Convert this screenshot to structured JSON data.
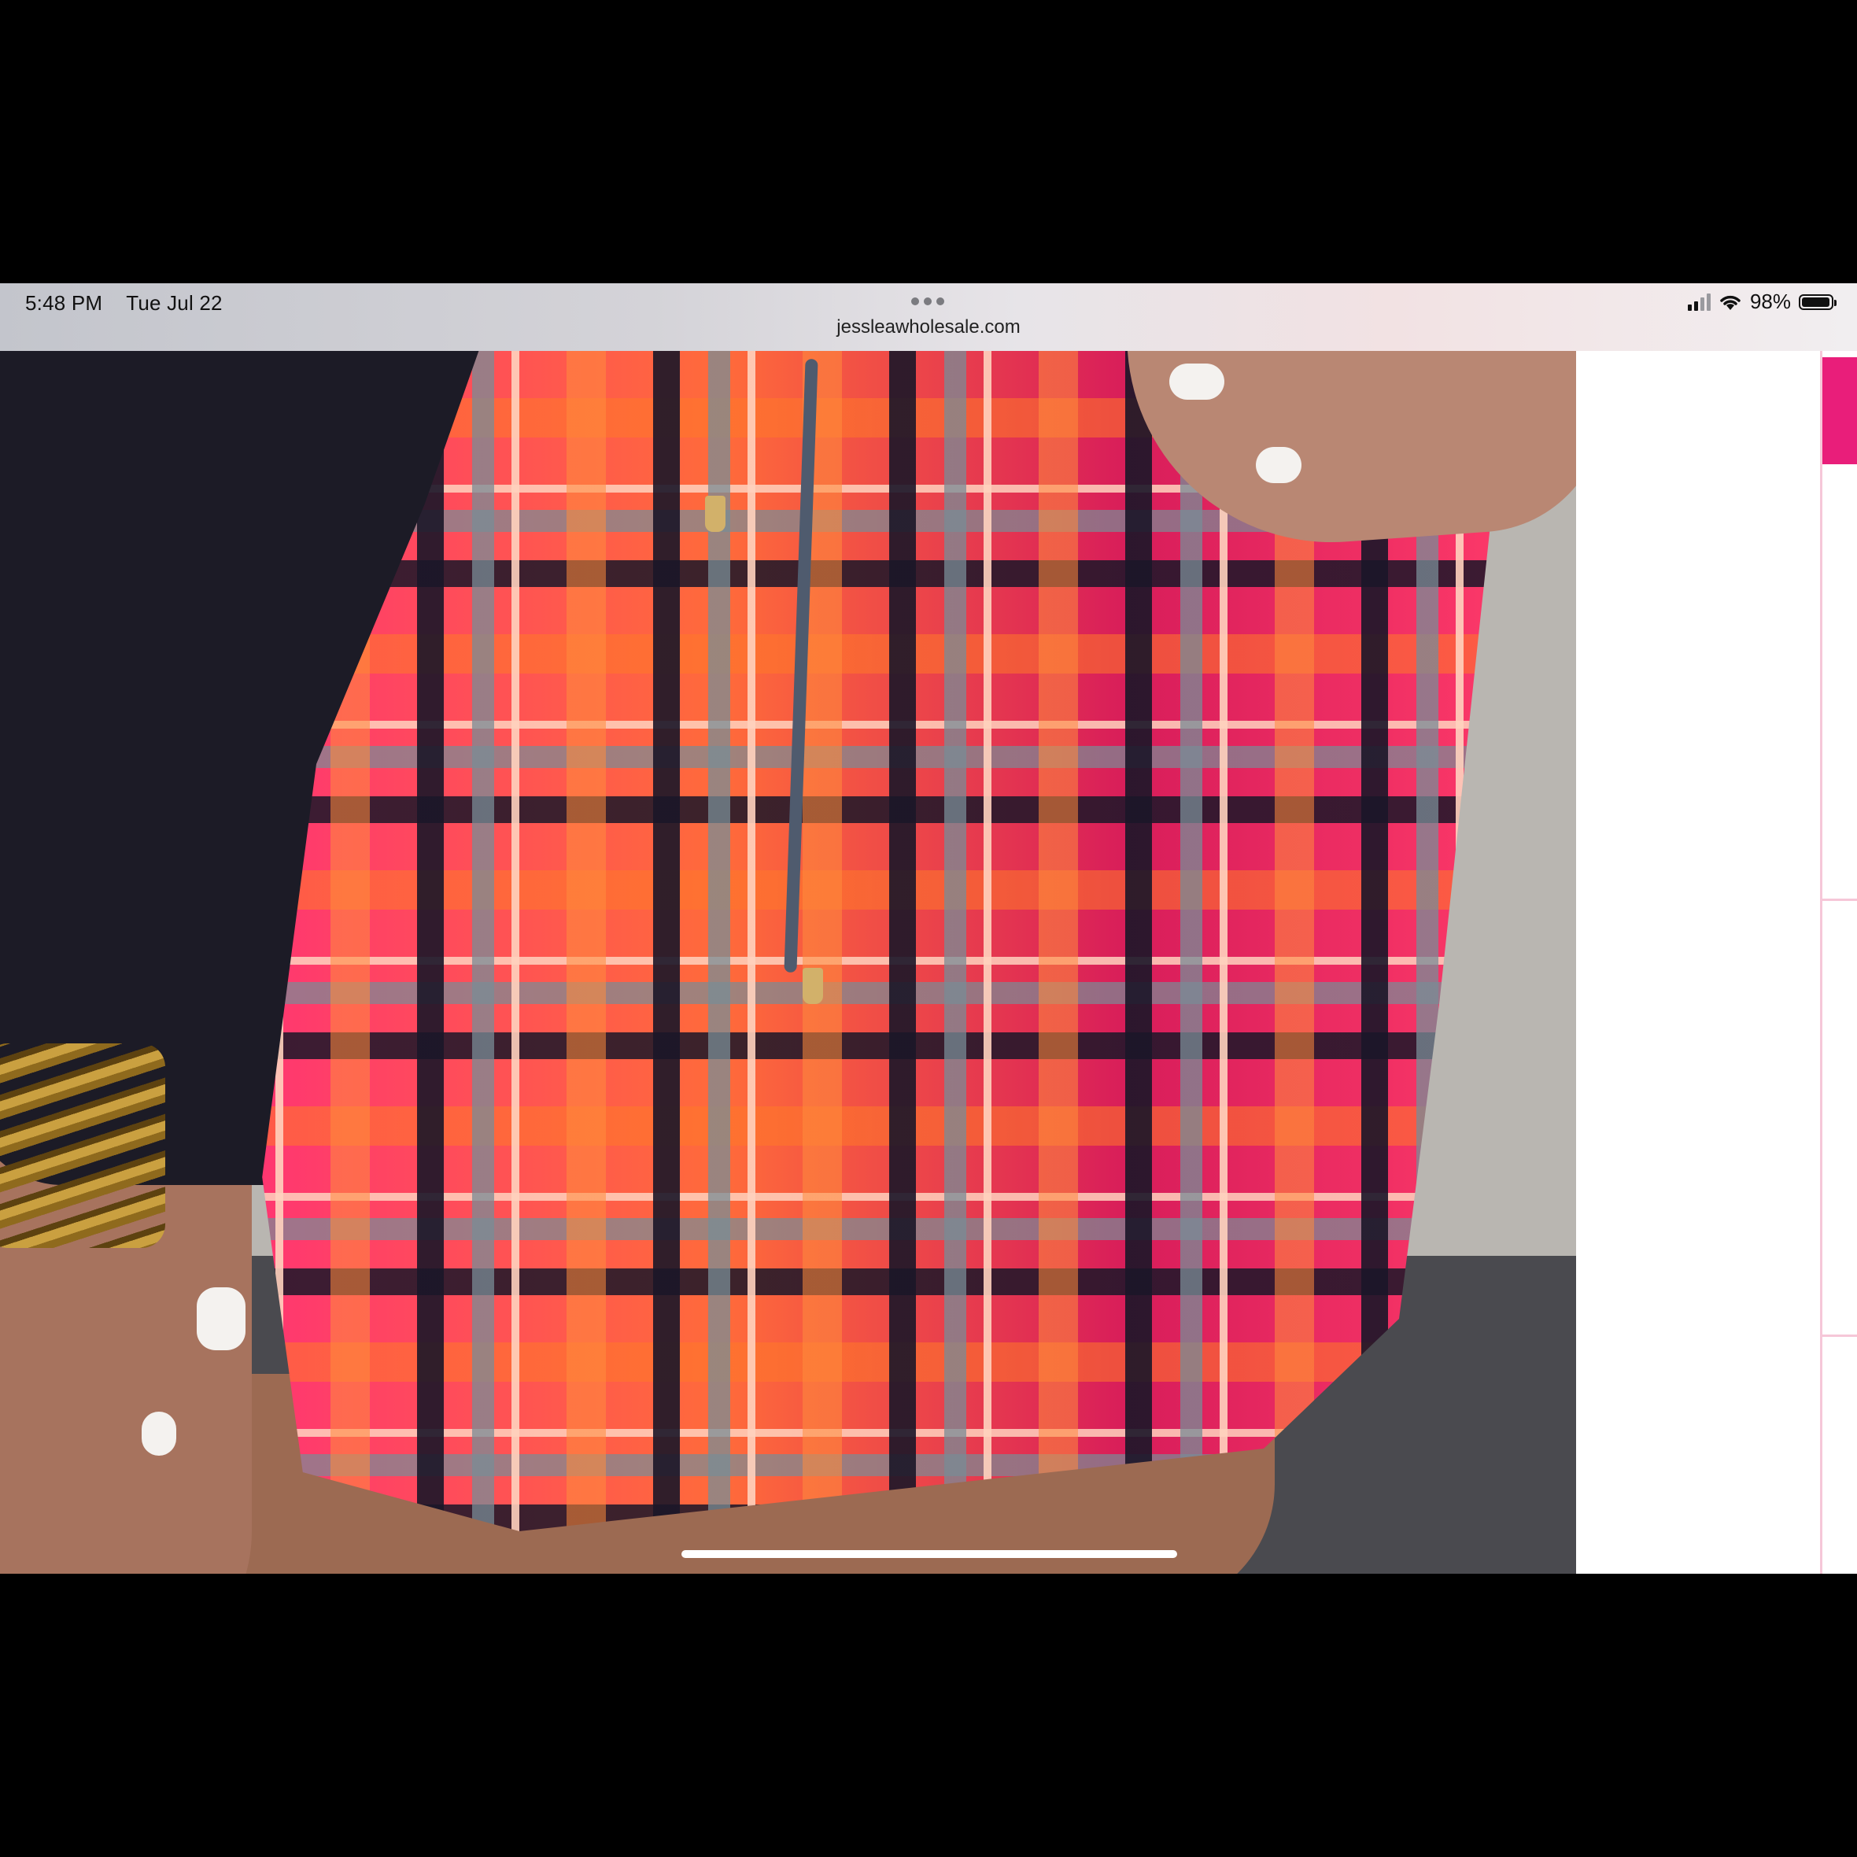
{
  "status_bar": {
    "time": "5:48 PM",
    "date": "Tue Jul 22",
    "battery_percent": "98%",
    "battery_level": 0.98
  },
  "browser": {
    "url": "jessleawholesale.com"
  },
  "product_image": {
    "subject": "plaid drawstring mini skirt",
    "colors": {
      "pink": "#ff2d7a",
      "orange": "#ff6b3a",
      "navy": "#1a1628",
      "slate": "#788c96"
    }
  },
  "side_panel": {
    "accent_color": "#e91e7a"
  }
}
